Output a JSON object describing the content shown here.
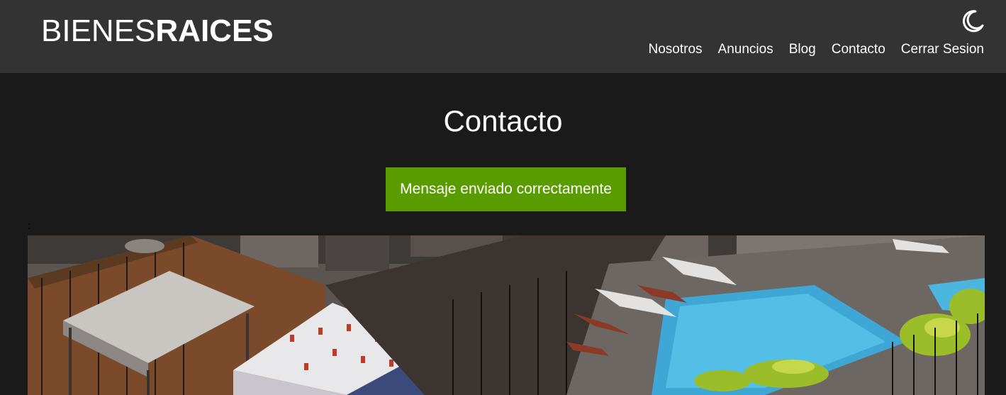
{
  "header": {
    "logo_light": "BIENES",
    "logo_bold": "RAICES",
    "theme_toggle_icon": "moon-icon",
    "nav": [
      "Nosotros",
      "Anuncios",
      "Blog",
      "Contacto",
      "Cerrar Sesion"
    ]
  },
  "main": {
    "title": "Contacto",
    "alert_message": "Mensaje enviado correctamente",
    "alert_color": "#5a9c00"
  },
  "colors": {
    "header_bg": "#333333",
    "page_bg": "#1a1a1a"
  }
}
